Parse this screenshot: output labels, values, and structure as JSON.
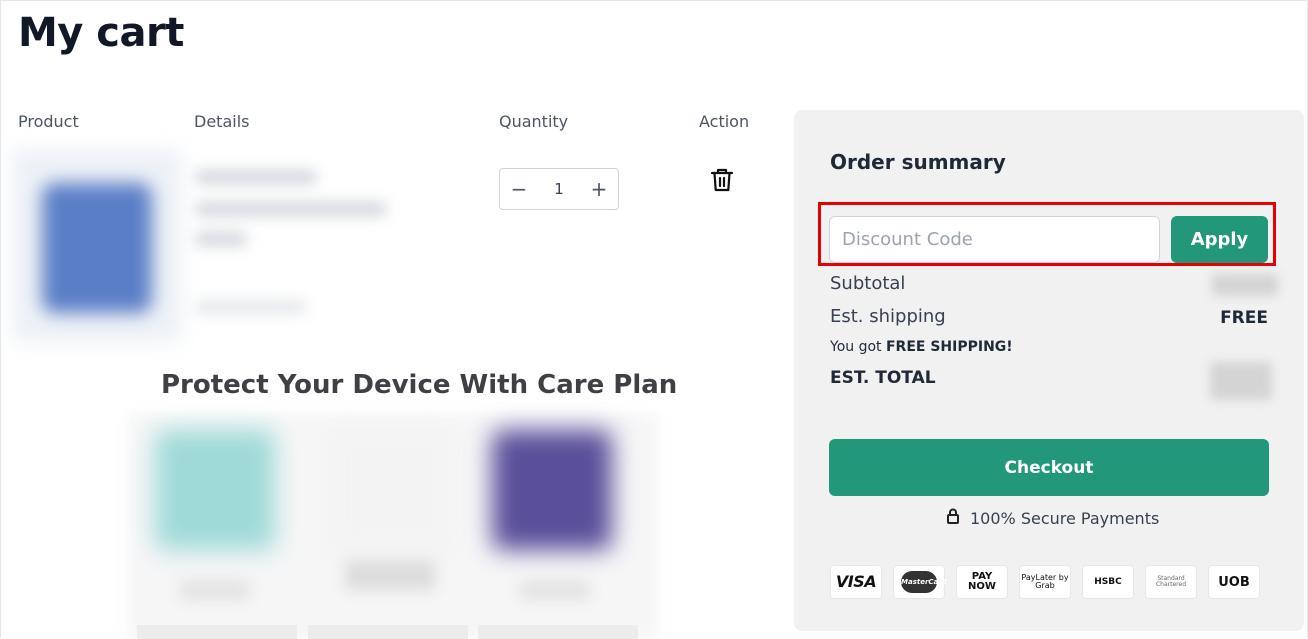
{
  "page": {
    "title": "My cart"
  },
  "cart": {
    "columns": {
      "product": "Product",
      "details": "Details",
      "quantity": "Quantity",
      "action": "Action"
    },
    "item": {
      "quantity": "1",
      "decrement": "−",
      "increment": "+"
    }
  },
  "care": {
    "title": "Protect Your Device With Care Plan"
  },
  "summary": {
    "title": "Order summary",
    "discount_placeholder": "Discount Code",
    "apply_label": "Apply",
    "subtotal_label": "Subtotal",
    "shipping_label": "Est. shipping",
    "shipping_value": "FREE",
    "free_note_prefix": "You got ",
    "free_note_bold": "FREE SHIPPING!",
    "total_label": "EST. TOTAL",
    "checkout_label": "Checkout",
    "secure_label": "100% Secure Payments",
    "payments": [
      {
        "name": "VISA",
        "icon": "visa-icon"
      },
      {
        "name": "MasterCard",
        "icon": "mastercard-icon"
      },
      {
        "name": "PAY NOW",
        "icon": "paynow-icon"
      },
      {
        "name": "PayLater by Grab",
        "icon": "paylater-icon"
      },
      {
        "name": "HSBC",
        "icon": "hsbc-icon"
      },
      {
        "name": "Standard Chartered",
        "icon": "standard-chartered-icon"
      },
      {
        "name": "UOB",
        "icon": "uob-icon"
      }
    ]
  },
  "colors": {
    "accent": "#22977a",
    "highlight": "#e60000",
    "panel": "#f1f1f1"
  }
}
